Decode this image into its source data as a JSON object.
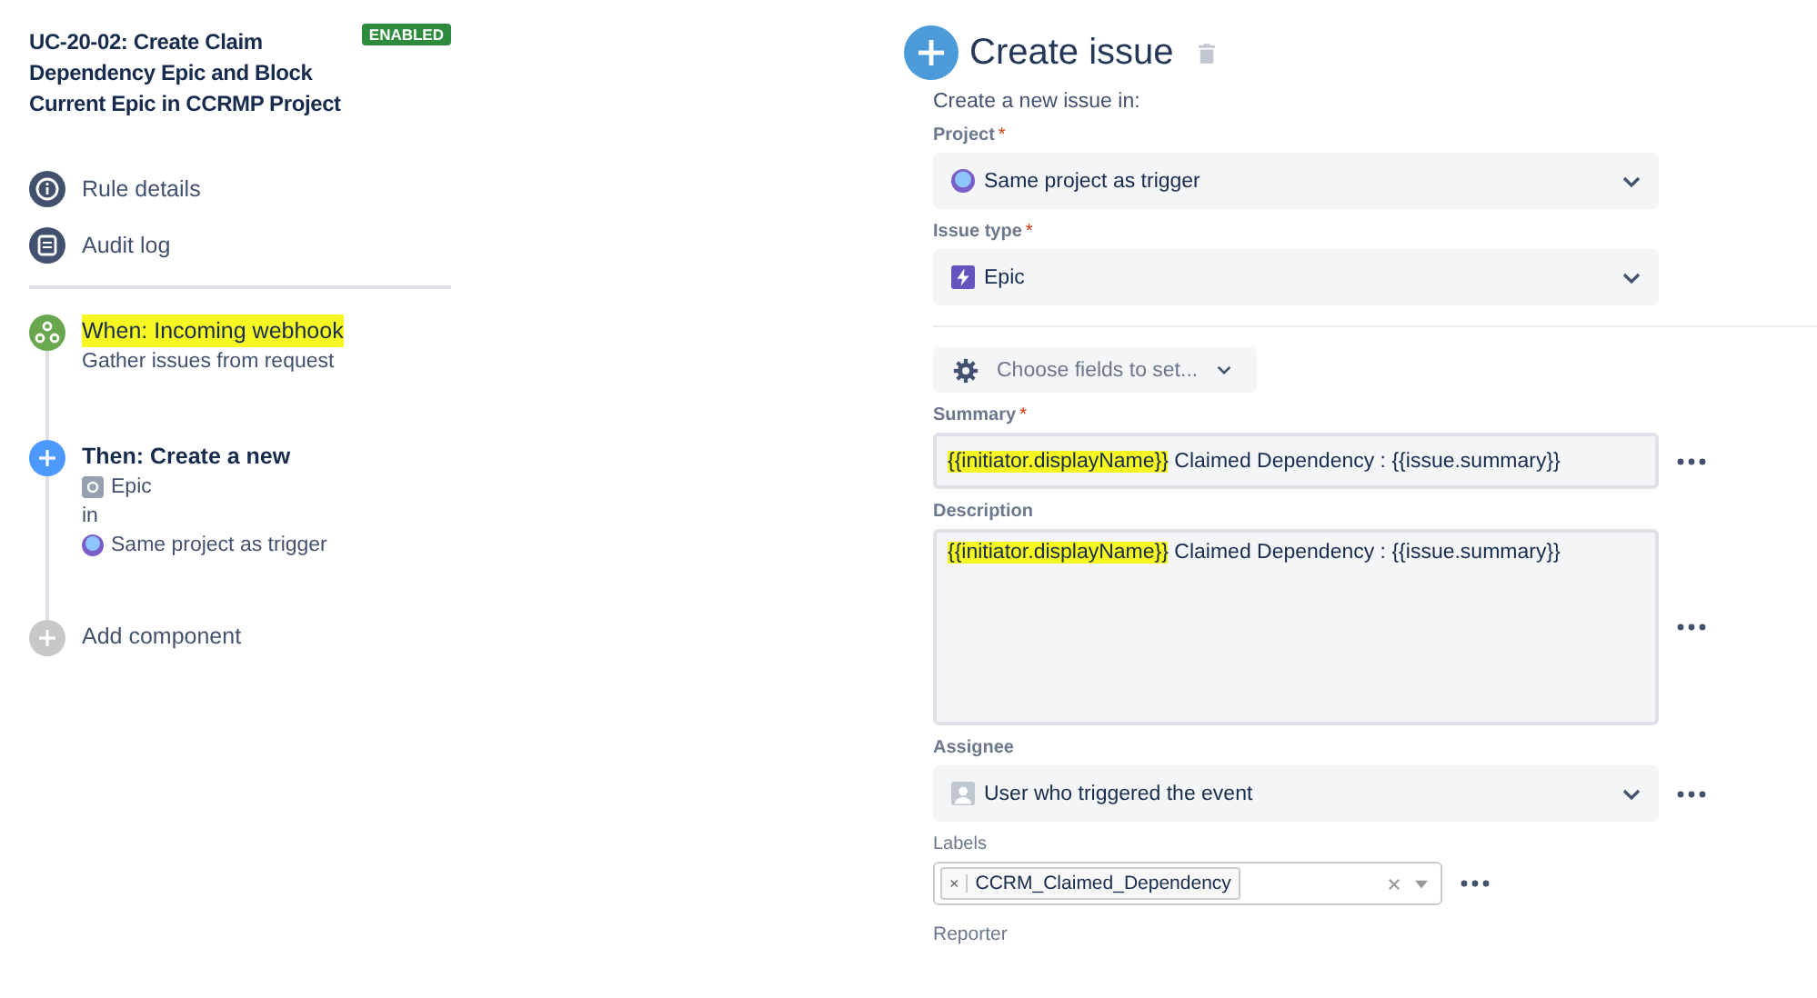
{
  "rule": {
    "title": "UC-20-02: Create Claim Dependency Epic and Block Current Epic in CCRMP Project",
    "status": "ENABLED"
  },
  "nav": [
    {
      "label": "Rule details"
    },
    {
      "label": "Audit log"
    }
  ],
  "flow": [
    {
      "kind": "trigger",
      "title": "When: Incoming webhook",
      "highlighted": true,
      "lines": [
        {
          "kind": "plain",
          "text": "Gather issues from request"
        }
      ]
    },
    {
      "kind": "action",
      "title": "Then: Create a new",
      "lines": [
        {
          "kind": "issue_type",
          "text": "Epic"
        },
        {
          "kind": "plain",
          "text": "in"
        },
        {
          "kind": "project",
          "text": "Same project as trigger"
        }
      ]
    },
    {
      "kind": "add",
      "title": "Add component"
    }
  ],
  "panel": {
    "title": "Create issue",
    "intro": "Create a new issue in:",
    "choose_fields": "Choose fields to set...",
    "fields": [
      {
        "kind": "project_select",
        "label": "Project",
        "required_mark": "*",
        "value": [
          {
            "text": "Same project as trigger"
          }
        ]
      },
      {
        "kind": "type_select",
        "label": "Issue type",
        "required_mark": "*",
        "value": [
          {
            "text": "Epic"
          }
        ]
      },
      {
        "kind": "divider"
      },
      {
        "kind": "choose"
      },
      {
        "kind": "text",
        "label": "Summary",
        "required_mark": "*",
        "value": [
          {
            "text": "{{initiator.displayName}}",
            "highlighted": true
          },
          {
            "text": " Claimed Dependency : {{issue.summary}}"
          }
        ],
        "more": true
      },
      {
        "kind": "textarea",
        "label": "Description",
        "value": [
          {
            "text": "{{initiator.displayName}}",
            "highlighted": true
          },
          {
            "text": " Claimed Dependency : {{issue.summary}}"
          }
        ],
        "more": true
      },
      {
        "kind": "user_select",
        "label": "Assignee",
        "value": [
          {
            "text": "User who triggered the event"
          }
        ],
        "more": true
      },
      {
        "kind": "labels",
        "label": "Labels",
        "tags": [
          {
            "remove": "×",
            "text": "CCRM_Claimed_Dependency"
          }
        ],
        "more": true
      },
      {
        "kind": "caption",
        "label": "Reporter"
      }
    ]
  }
}
